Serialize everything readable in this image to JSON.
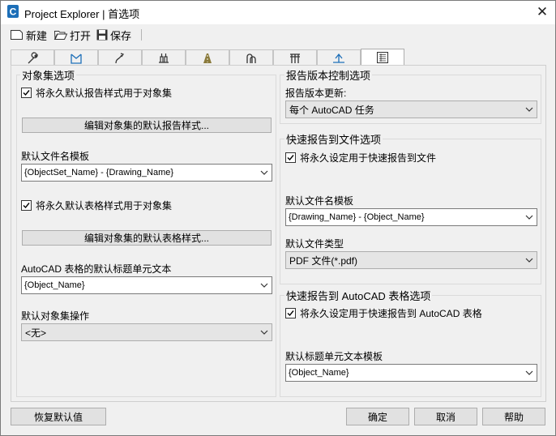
{
  "window": {
    "title": "Project Explorer | 首选项"
  },
  "toolbar": {
    "new_label": "新建",
    "open_label": "打开",
    "save_label": "保存"
  },
  "tabs": [
    {
      "icon": "wrench-icon"
    },
    {
      "icon": "surface-icon"
    },
    {
      "icon": "alignment-icon"
    },
    {
      "icon": "pipe-network-icon"
    },
    {
      "icon": "road-icon"
    },
    {
      "icon": "pressure-pipe-icon"
    },
    {
      "icon": "structure-icon"
    },
    {
      "icon": "profile-icon"
    },
    {
      "icon": "report-icon",
      "active": true
    }
  ],
  "left": {
    "group_title": "对象集选项",
    "report_style_check": "将永久默认报告样式用于对象集",
    "edit_report_style_btn": "编辑对象集的默认报告样式...",
    "filename_template_label": "默认文件名模板",
    "filename_template_value": "{ObjectSet_Name} - {Drawing_Name}",
    "table_style_check": "将永久默认表格样式用于对象集",
    "edit_table_style_btn": "编辑对象集的默认表格样式...",
    "table_title_label": "AutoCAD 表格的默认标题单元文本",
    "table_title_value": "{Object_Name}",
    "default_action_label": "默认对象集操作",
    "default_action_value": "<无>"
  },
  "right": {
    "version_group_title": "报告版本控制选项",
    "version_update_label": "报告版本更新:",
    "version_update_value": "每个 AutoCAD 任务",
    "file_group_title": "快速报告到文件选项",
    "file_check": "将永久设定用于快速报告到文件",
    "file_template_label": "默认文件名模板",
    "file_template_value": "{Drawing_Name} - {Object_Name}",
    "file_type_label": "默认文件类型",
    "file_type_value": "PDF 文件(*.pdf)",
    "table_group_title": "快速报告到 AutoCAD 表格选项",
    "table_check": "将永久设定用于快速报告到 AutoCAD 表格",
    "table_title_label": "默认标题单元文本模板",
    "table_title_value": "{Object_Name}"
  },
  "buttons": {
    "restore": "恢复默认值",
    "ok": "确定",
    "cancel": "取消",
    "help": "帮助"
  }
}
